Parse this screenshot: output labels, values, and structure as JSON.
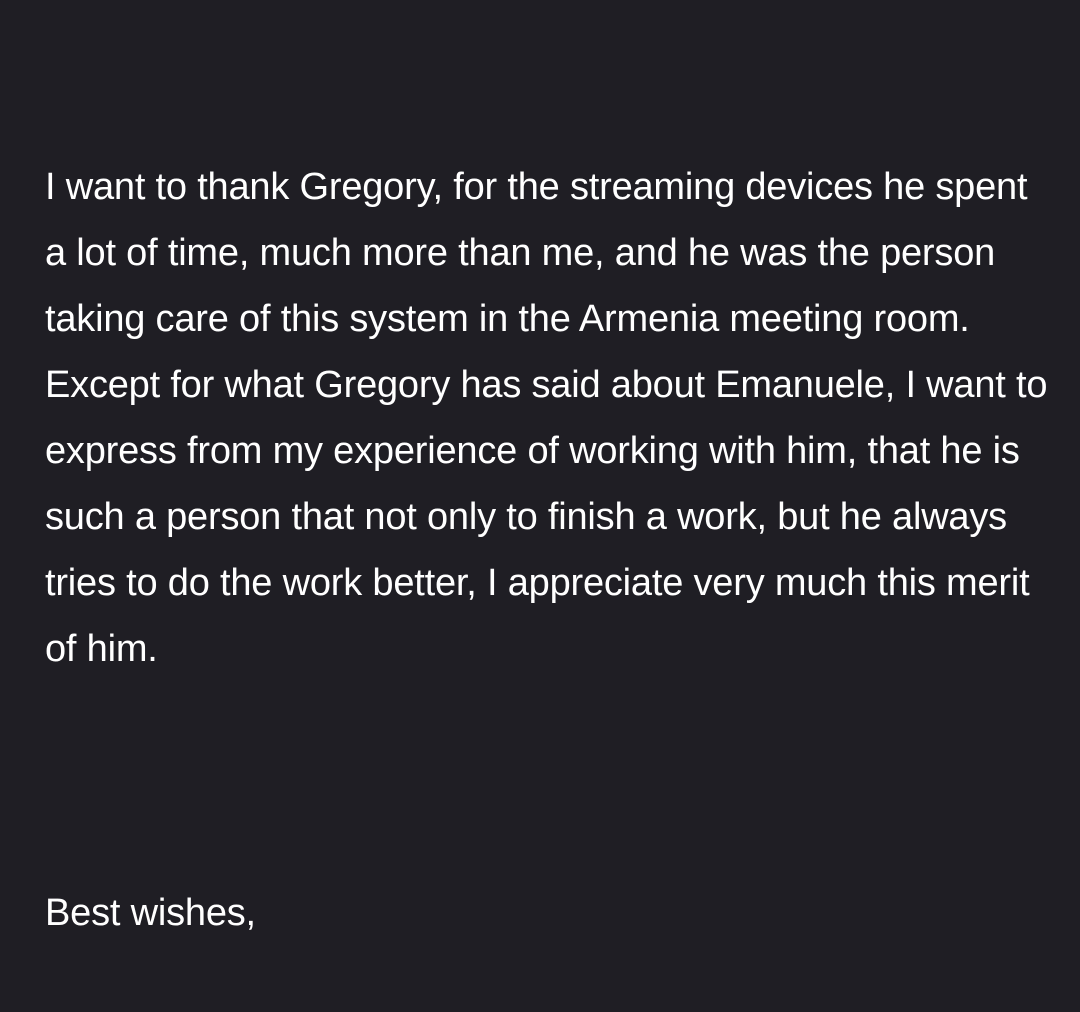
{
  "message": {
    "paragraph": "I want to thank Gregory, for the streaming devices he spent a lot of time, much more than me, and he was the person taking care of this system in the Armenia meeting room.  Except for what Gregory has said about Emanuele, I want to express from my experience of working with him, that he is such a person that not only to finish a work, but he always tries to do the work better, I appreciate very much this merit of him.",
    "signoff": "Best wishes,"
  }
}
